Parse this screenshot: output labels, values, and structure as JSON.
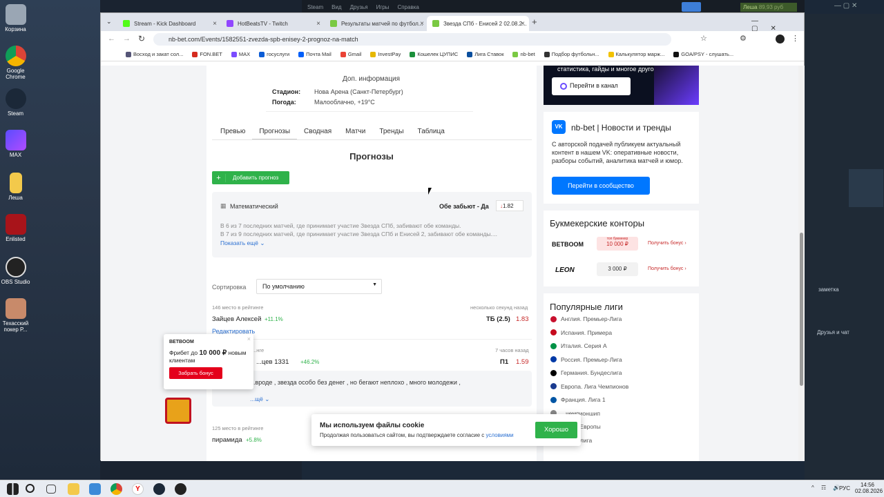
{
  "desktop": {
    "icons": [
      "Корзина",
      "Google Chrome",
      "Steam",
      "MAX",
      "Леша",
      "Enlisted",
      "OBS Studio",
      "Техасский покер Р..."
    ]
  },
  "steam": {
    "menu": [
      "Steam",
      "Вид",
      "Друзья",
      "Игры",
      "Справка"
    ],
    "user": "Леша",
    "balance": "89,93 руб",
    "side_note": "заметка",
    "friends": "Друзья и чат"
  },
  "browser": {
    "tabs": [
      {
        "label": "Stream - Kick Dashboard",
        "color": "#53fc18"
      },
      {
        "label": "HotBeatsTV - Twitch",
        "color": "#9146ff"
      },
      {
        "label": "Результаты матчей по футбол...",
        "color": "#7ac943"
      },
      {
        "label": "Звезда СПб - Енисей 2 02.08.2...",
        "color": "#7ac943"
      }
    ],
    "url": "nb-bet.com/Events/1582551-zvezda-spb-enisey-2-prognoz-na-match",
    "bookmarks": [
      "Восход и закат сол...",
      "FON.BET",
      "MAX",
      "госуслуги",
      "Почта Mail",
      "Gmail",
      "InvestPay",
      "Кошелек ЦУПИС",
      "Лига Ставок",
      "nb-bet",
      "Подбор футбольн...",
      "Калькулятор марж...",
      "GOA/PSY - слушать..."
    ]
  },
  "info": {
    "title": "Доп. информация",
    "stadium_label": "Стадион:",
    "stadium": "Нова Арена (Санкт-Петербург)",
    "weather_label": "Погода:",
    "weather": "Малооблачно, +19°C"
  },
  "content_tabs": [
    "Превью",
    "Прогнозы",
    "Сводная",
    "Матчи",
    "Тренды",
    "Таблица"
  ],
  "forecasts": {
    "title": "Прогнозы",
    "add_button": "Добавить прогноз",
    "math": {
      "label": "Математический",
      "bet": "Обе забьют - Да",
      "odds": "1.82",
      "line1": "В 6 из 7 последних матчей, где принимает участие Звезда СПб, забивают обе команды.",
      "line2": "В 7 из 9 последних матчей, где принимает участие Звезда СПб и Енисей 2, забивают обе команды....",
      "more": "Показать ещё"
    },
    "sort_label": "Сортировка",
    "sort_value": "По умолчанию",
    "items": [
      {
        "rank": "146 место в рейтинге",
        "time": "несколько секунд назад",
        "name": "Зайцев Алексей",
        "pct": "+11.1%",
        "bet": "ТБ (2.5)",
        "odds": "1.83",
        "edit": "Редактировать"
      },
      {
        "rank": "...нге",
        "time": "7 часов назад",
        "name": "...цев 1331",
        "pct": "+46.2%",
        "bet": "П1",
        "odds": "1.59",
        "comment": "...вроде , звезда особо без денег , но бегают неплохо , много молодежи ,",
        "more": "...щё"
      },
      {
        "rank": "125 место в рейтинге",
        "name": "пирамида",
        "pct": "+5.8%"
      }
    ]
  },
  "promo": {
    "brand": "BETBOOM",
    "text_a": "Фрибет до ",
    "amount": "10 000 ₽",
    "text_b": " новым клиентам",
    "button": "Забрать бонус"
  },
  "sidebar": {
    "banner_text": "статистика, гайды и многое другое",
    "channel_button": "Перейти в канал",
    "vk_title": "nb-bet | Новости и тренды",
    "vk_text": "С авторской подачей публикуем актуальный контент в нашем VK: оперативные новости, разборы событий, аналитика матчей и юмор.",
    "vk_button": "Перейти в сообщество",
    "bookmakers_title": "Букмекерские конторы",
    "bookmakers": [
      {
        "name": "BETBOOM",
        "tag": "топ букмекер",
        "bonus": "10 000 ₽",
        "link": "Получить бонус"
      },
      {
        "name": "LEON",
        "bonus": "3 000 ₽",
        "link": "Получить бонус"
      }
    ],
    "leagues_title": "Популярные лиги",
    "leagues": [
      "Англия. Премьер-Лига",
      "Испания. Примера",
      "Италия. Серия А",
      "Россия. Премьер-Лига",
      "Германия. Бундеслига",
      "Европа. Лига Чемпионов",
      "Франция. Лига 1",
      "...чемпионшип",
      "...Лига Европы",
      "...рвая лига"
    ],
    "league_colors": [
      "#c8102e",
      "#c60b1e",
      "#009246",
      "#0039a6",
      "#000000",
      "#1a3b8f",
      "#0055a4",
      "#888",
      "#888",
      "#888"
    ]
  },
  "cookie": {
    "title": "Мы используем файлы cookie",
    "text": "Продолжая пользоваться сайтом, вы подтверждаете согласие с ",
    "link": "условиями",
    "button": "Хорошо"
  },
  "taskbar": {
    "lang": "РУС",
    "time": "14:56",
    "date": "02.08.2026"
  }
}
